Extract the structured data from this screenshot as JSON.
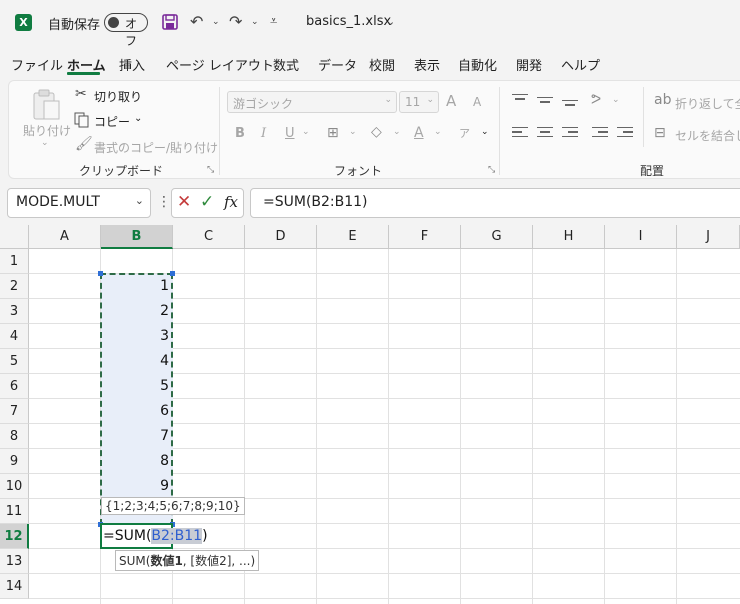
{
  "titlebar": {
    "app_icon": "excel-logo",
    "app_letter": "X",
    "autosave_label": "自動保存",
    "autosave_state": "オフ",
    "filename": "basics_1.xlsx"
  },
  "menu": {
    "tabs": [
      "ファイル",
      "ホーム",
      "挿入",
      "ページ レイアウト",
      "数式",
      "データ",
      "校閲",
      "表示",
      "自動化",
      "開発",
      "ヘルプ"
    ],
    "active": "ホーム"
  },
  "ribbon": {
    "clipboard": {
      "paste": "貼り付け",
      "cut": "切り取り",
      "copy": "コピー",
      "format_painter": "書式のコピー/貼り付け",
      "label": "クリップボード"
    },
    "font": {
      "font_name": "游ゴシック",
      "font_size": "11",
      "grow": "A",
      "shrink": "A",
      "bold": "B",
      "italic": "I",
      "underline": "U",
      "font_color": "A",
      "phonetic": "ア",
      "label": "フォント"
    },
    "alignment": {
      "wrap_text": "折り返して全体",
      "merge": "セルを結合して",
      "label": "配置"
    }
  },
  "formula_bar": {
    "name_box": "MODE.MULT",
    "cancel_icon": "✕",
    "enter_icon": "✓",
    "fx": "fx",
    "formula": "=SUM(B2:B11)"
  },
  "sheet": {
    "columns": [
      "A",
      "B",
      "C",
      "D",
      "E",
      "F",
      "G",
      "H",
      "I",
      "J"
    ],
    "selected_column": "B",
    "rows": [
      "1",
      "2",
      "3",
      "4",
      "5",
      "6",
      "7",
      "8",
      "9",
      "10",
      "11",
      "12",
      "13",
      "14"
    ],
    "selected_row": "12",
    "column_b_values": [
      "1",
      "2",
      "3",
      "4",
      "5",
      "6",
      "7",
      "8",
      "9"
    ],
    "array_tooltip": "{1;2;3;4;5;6;7;8;9;10}",
    "edit_prefix": "=SUM(",
    "edit_ref": "B2:B11",
    "edit_suffix": ")",
    "function_tooltip_name": "SUM(",
    "function_tooltip_arg1": "数値1",
    "function_tooltip_rest": ", [数値2], ...)"
  },
  "colors": {
    "accent": "#107c41",
    "range_border": "#2e6b47",
    "range_fill": "#e8eef9",
    "ref_highlight": "#2f5fcf"
  }
}
